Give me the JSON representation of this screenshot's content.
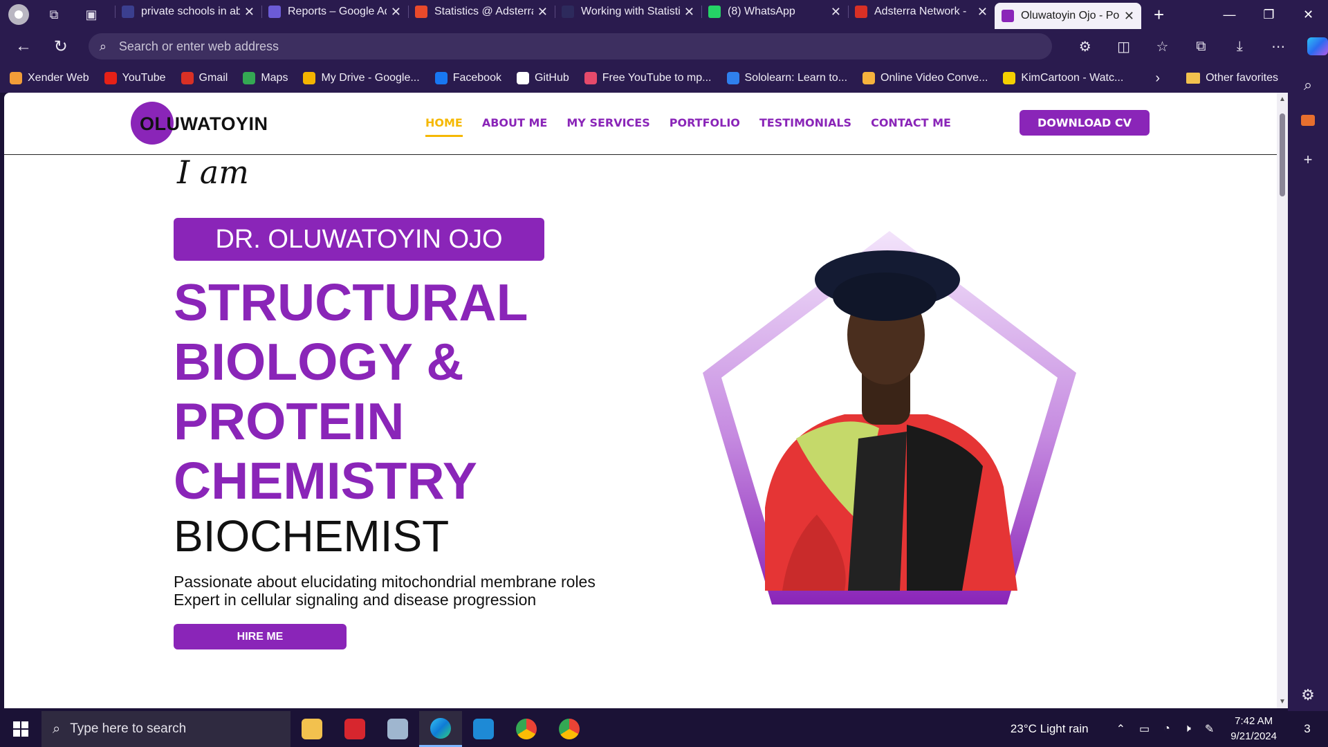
{
  "browser": {
    "tabs": [
      {
        "title": "private schools in ab",
        "favicon_color": "#3b3f8f",
        "active": false
      },
      {
        "title": "Reports – Google Ad",
        "favicon_color": "#6b5bd6",
        "active": false
      },
      {
        "title": "Statistics @ Adsterra",
        "favicon_color": "#e94a2b",
        "active": false
      },
      {
        "title": "Working with Statisti",
        "favicon_color": "#2d2a5c",
        "active": false
      },
      {
        "title": "(8) WhatsApp",
        "favicon_color": "#25d366",
        "active": false
      },
      {
        "title": "Adsterra Network - ",
        "favicon_color": "#d93025",
        "active": false
      },
      {
        "title": "Oluwatoyin Ojo - Po",
        "favicon_color": "#8a25b8",
        "active": true
      }
    ],
    "address_placeholder": "Search or enter web address",
    "favorites": [
      {
        "label": "Xender Web",
        "color": "#f29d38"
      },
      {
        "label": "YouTube",
        "color": "#e62117"
      },
      {
        "label": "Gmail",
        "color": "#d93025"
      },
      {
        "label": "Maps",
        "color": "#34a853"
      },
      {
        "label": "My Drive - Google...",
        "color": "#f4b400"
      },
      {
        "label": "Facebook",
        "color": "#1877f2"
      },
      {
        "label": "GitHub",
        "color": "#ffffff"
      },
      {
        "label": "Free YouTube to mp...",
        "color": "#e64a6b"
      },
      {
        "label": "Sololearn: Learn to...",
        "color": "#2f80ed"
      },
      {
        "label": "Online Video Conve...",
        "color": "#f6b33d"
      },
      {
        "label": "KimCartoon - Watc...",
        "color": "#f5d000"
      }
    ],
    "other_favorites": "Other favorites"
  },
  "site": {
    "logo": "OLUWATOYIN",
    "nav": [
      {
        "label": "HOME",
        "active": true
      },
      {
        "label": "ABOUT ME",
        "active": false
      },
      {
        "label": "MY SERVICES",
        "active": false
      },
      {
        "label": "PORTFOLIO",
        "active": false
      },
      {
        "label": "TESTIMONIALS",
        "active": false
      },
      {
        "label": "CONTACT ME",
        "active": false
      }
    ],
    "download_cv": "DOWNLOAD CV",
    "hero": {
      "intro": "I am",
      "name": "DR. OLUWATOYIN OJO",
      "headline_lines": [
        "STRUCTURAL",
        "BIOLOGY &",
        "PROTEIN",
        "CHEMISTRY"
      ],
      "role": "BIOCHEMIST",
      "desc_lines": [
        "Passionate about elucidating mitochondrial membrane roles",
        "Expert in cellular signaling and disease progression"
      ],
      "hire_button": "HIRE ME"
    },
    "accent_color": "#8a25b8",
    "active_nav_color": "#f5b800"
  },
  "taskbar": {
    "search_placeholder": "Type here to search",
    "weather": "23°C  Light rain",
    "time": "7:42 AM",
    "date": "9/21/2024",
    "notifications": "3"
  }
}
